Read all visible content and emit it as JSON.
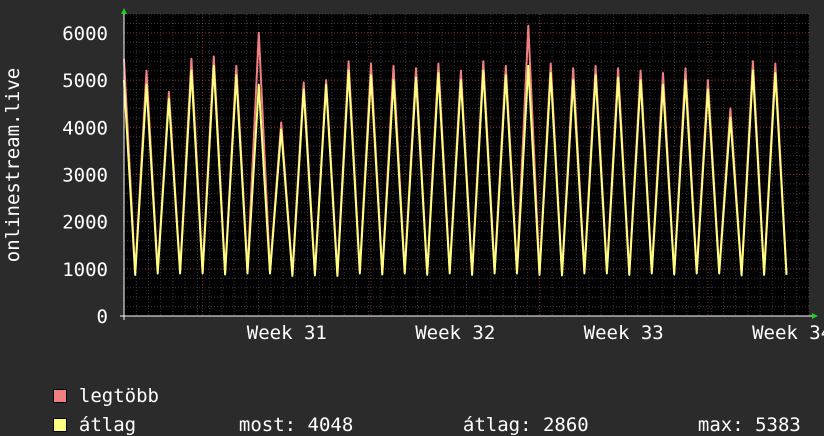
{
  "chart_data": {
    "type": "line",
    "ylabel": "onlinestream.live",
    "ylim": [
      0,
      6400
    ],
    "y_ticks": [
      0,
      1000,
      2000,
      3000,
      4000,
      5000,
      6000
    ],
    "x_ticks": [
      "Week 31",
      "Week 32",
      "Week 33",
      "Week 34"
    ],
    "grid": true,
    "x": [
      0,
      0.5,
      1,
      1.5,
      2,
      2.5,
      3,
      3.5,
      4,
      4.5,
      5,
      5.5,
      6,
      6.5,
      7,
      7.5,
      8,
      8.5,
      9,
      9.5,
      10,
      10.5,
      11,
      11.5,
      12,
      12.5,
      13,
      13.5,
      14,
      14.5,
      15,
      15.5,
      16,
      16.5,
      17,
      17.5,
      18,
      18.5,
      19,
      19.5,
      20,
      20.5,
      21,
      21.5,
      22,
      22.5,
      23,
      23.5,
      24,
      24.5,
      25,
      25.5,
      26,
      26.5,
      27,
      27.5,
      28,
      28.5,
      29,
      29.5,
      30,
      30.5
    ],
    "series": [
      {
        "name": "legtöbb",
        "color": "#f08080",
        "values": [
          5450,
          900,
          5200,
          950,
          4750,
          950,
          5450,
          950,
          5500,
          900,
          5300,
          950,
          6000,
          950,
          4100,
          900,
          4950,
          900,
          5000,
          900,
          5400,
          950,
          5350,
          900,
          5300,
          950,
          5250,
          900,
          5350,
          950,
          5200,
          900,
          5400,
          950,
          5300,
          950,
          6150,
          900,
          5350,
          900,
          5250,
          950,
          5300,
          950,
          5250,
          900,
          5200,
          950,
          5150,
          900,
          5250,
          950,
          5000,
          950,
          4400,
          900,
          5400,
          900,
          5350,
          900
        ]
      },
      {
        "name": "átlag",
        "color": "#ffff80",
        "values": [
          5000,
          870,
          4900,
          900,
          4600,
          900,
          5200,
          900,
          5300,
          880,
          5100,
          900,
          4900,
          900,
          3950,
          850,
          4800,
          860,
          4900,
          850,
          5200,
          900,
          5100,
          880,
          5000,
          900,
          5050,
          870,
          5150,
          900,
          5000,
          870,
          5200,
          900,
          5100,
          900,
          5300,
          870,
          5150,
          860,
          5000,
          900,
          5100,
          900,
          5050,
          870,
          5000,
          900,
          4900,
          880,
          5000,
          900,
          4800,
          900,
          4200,
          860,
          5200,
          870,
          5150,
          870
        ]
      }
    ],
    "legend": [
      {
        "label": "legtöbb",
        "color": "#f08080"
      },
      {
        "label": "átlag",
        "color": "#ffff80"
      }
    ],
    "stats": {
      "most_label": "most:",
      "most_value": "4048",
      "atlag_label": "átlag:",
      "atlag_value": "2860",
      "max_label": "max:",
      "max_value": "5383"
    }
  }
}
